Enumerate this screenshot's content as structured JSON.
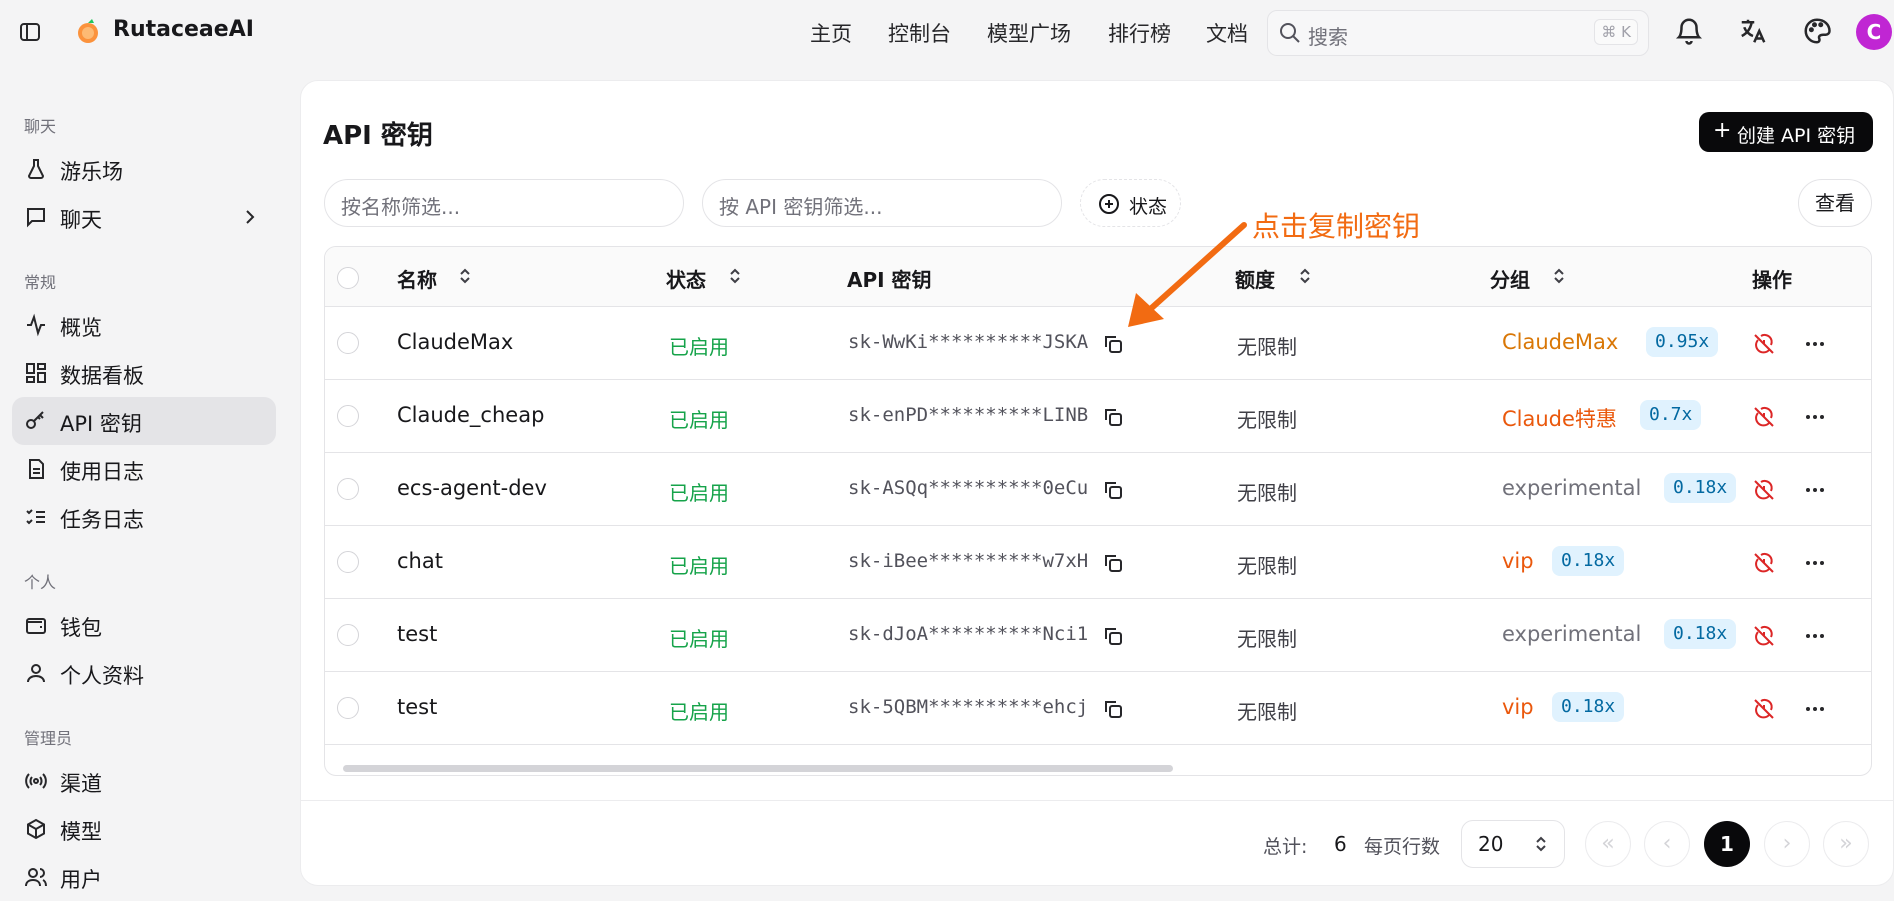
{
  "app": {
    "brand": "RutaceaeAI",
    "avatar_letter": "C",
    "avatar_color": "#c026d3"
  },
  "nav": [
    "主页",
    "控制台",
    "模型广场",
    "排行榜",
    "文档"
  ],
  "search": {
    "placeholder": "搜索",
    "shortcut": "⌘ K"
  },
  "sidebar": {
    "sections": [
      {
        "title": "聊天",
        "items": [
          "游乐场",
          "聊天"
        ]
      },
      {
        "title": "常规",
        "items": [
          "概览",
          "数据看板",
          "API 密钥",
          "使用日志",
          "任务日志"
        ]
      },
      {
        "title": "个人",
        "items": [
          "钱包",
          "个人资料"
        ]
      },
      {
        "title": "管理员",
        "items": [
          "渠道",
          "模型",
          "用户"
        ]
      }
    ],
    "active_item": "API 密钥"
  },
  "page": {
    "title": "API 密钥",
    "create_button": "创建 API 密钥",
    "filter_name_placeholder": "按名称筛选...",
    "filter_key_placeholder": "按 API 密钥筛选...",
    "status_filter": "状态",
    "view_button": "查看",
    "annotation": "点击复制密钥"
  },
  "table": {
    "columns": [
      "名称",
      "状态",
      "API 密钥",
      "额度",
      "分组",
      "操作"
    ],
    "rows": [
      {
        "name": "ClaudeMax",
        "status": "已启用",
        "key": "sk-WwKi**********JSKA",
        "quota": "无限制",
        "group": "ClaudeMax",
        "group_color": "#d97706",
        "ratio": "0.95x"
      },
      {
        "name": "Claude_cheap",
        "status": "已启用",
        "key": "sk-enPD**********LINB",
        "quota": "无限制",
        "group": "Claude特惠",
        "group_color": "#ea580c",
        "ratio": "0.7x"
      },
      {
        "name": "ecs-agent-dev",
        "status": "已启用",
        "key": "sk-ASQq**********0eCu",
        "quota": "无限制",
        "group": "experimental",
        "group_color": "#71717a",
        "ratio": "0.18x"
      },
      {
        "name": "chat",
        "status": "已启用",
        "key": "sk-iBee**********w7xH",
        "quota": "无限制",
        "group": "vip",
        "group_color": "#ea580c",
        "ratio": "0.18x"
      },
      {
        "name": "test",
        "status": "已启用",
        "key": "sk-dJoA**********Nci1",
        "quota": "无限制",
        "group": "experimental",
        "group_color": "#71717a",
        "ratio": "0.18x"
      },
      {
        "name": "test",
        "status": "已启用",
        "key": "sk-5QBM**********ehcj",
        "quota": "无限制",
        "group": "vip",
        "group_color": "#ea580c",
        "ratio": "0.18x"
      }
    ]
  },
  "pagination": {
    "total_label": "总计:",
    "total": "6",
    "rows_label": "每页行数",
    "rows_per_page": "20",
    "current_page": "1"
  },
  "colors": {
    "status_enabled": "#16a34a",
    "annotation": "#f26b12",
    "action_red": "#dc2626"
  }
}
